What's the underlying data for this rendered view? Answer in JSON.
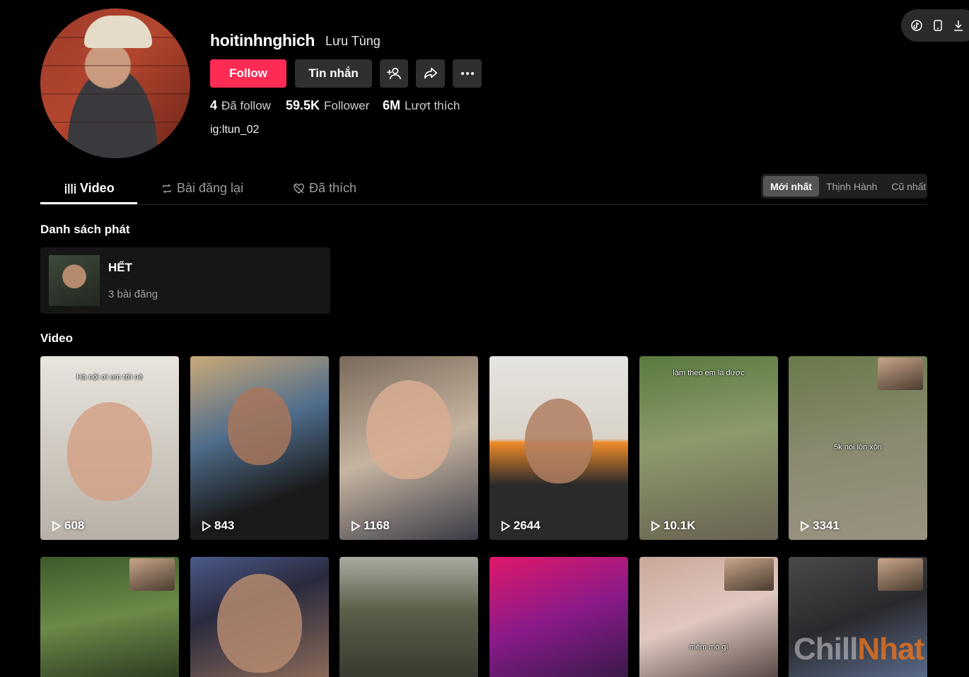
{
  "profile": {
    "username": "hoitinhnghich",
    "display_name": "Lưu Tùng",
    "bio": "ig:ltun_02",
    "following_count": "4",
    "following_label": "Đã follow",
    "followers_count": "59.5K",
    "followers_label": "Follower",
    "likes_count": "6M",
    "likes_label": "Lượt thích"
  },
  "actions": {
    "follow_label": "Follow",
    "message_label": "Tin nhắn"
  },
  "tabs": [
    {
      "label": "Video",
      "icon": "grid-bars-icon",
      "active": true
    },
    {
      "label": "Bài đăng lại",
      "icon": "repost-icon",
      "active": false
    },
    {
      "label": "Đã thích",
      "icon": "heart-slash-icon",
      "active": false
    }
  ],
  "sort": {
    "options": [
      "Mới nhất",
      "Thịnh Hành",
      "Cũ nhất"
    ],
    "selected": "Mới nhất"
  },
  "playlists": {
    "heading": "Danh sách phát",
    "items": [
      {
        "title": "HẾT",
        "count_label": "3 bài đăng"
      }
    ]
  },
  "videos": {
    "heading": "Video",
    "items": [
      {
        "views": "608",
        "caption": "Hà nội ơi em tới nè"
      },
      {
        "views": "843",
        "caption": ""
      },
      {
        "views": "1168",
        "caption": ""
      },
      {
        "views": "2644",
        "caption": ""
      },
      {
        "views": "10.1K",
        "caption": "làm theo em là được"
      },
      {
        "views": "3341",
        "caption": "5k nói lộn xộn"
      },
      {
        "views": "",
        "caption": ""
      },
      {
        "views": "",
        "caption": ""
      },
      {
        "views": "",
        "caption": ""
      },
      {
        "views": "",
        "caption": ""
      },
      {
        "views": "",
        "caption": "mếm mò gì"
      },
      {
        "views": "",
        "caption": ""
      }
    ]
  },
  "watermark": {
    "part1": "Chill",
    "part2": "Nhat"
  },
  "colors": {
    "background": "#000000",
    "follow_button": "#fe2c55",
    "secondary_button": "#2f2f2f",
    "muted_text": "#9b9b9b"
  }
}
